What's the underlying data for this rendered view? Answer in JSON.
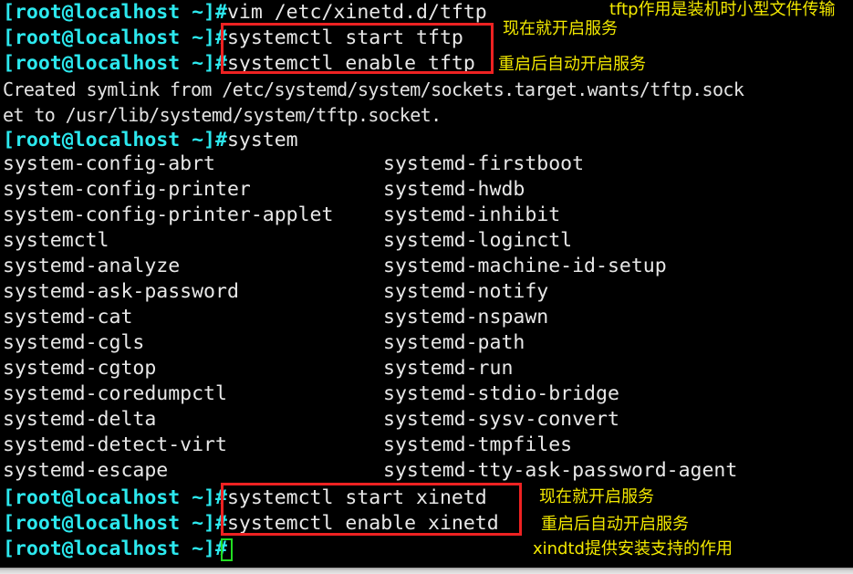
{
  "terminal": {
    "prompt": "[root@localhost ~]#",
    "colors": {
      "background": "#000000",
      "prompt": "#2ce8ee",
      "text": "#e8e8e8",
      "cursor": "#22dd22",
      "annotation_box": "#ee2222",
      "annotation_text": "#f2e800"
    },
    "lines": [
      {
        "prompt": "[root@localhost ~]#",
        "command": "vim /etc/xinetd.d/tftp"
      },
      {
        "prompt": "[root@localhost ~]#",
        "command": "systemctl start tftp"
      },
      {
        "prompt": "[root@localhost ~]#",
        "command": "systemctl enable tftp"
      }
    ],
    "output": [
      "Created symlink from /etc/systemd/system/sockets.target.wants/tftp.sock",
      "et to /usr/lib/systemd/system/tftp.socket."
    ],
    "tab_line": {
      "prompt": "[root@localhost ~]#",
      "command": "system"
    },
    "completions": [
      {
        "left": "system-config-abrt",
        "right": "systemd-firstboot"
      },
      {
        "left": "system-config-printer",
        "right": "systemd-hwdb"
      },
      {
        "left": "system-config-printer-applet",
        "right": "systemd-inhibit"
      },
      {
        "left": "systemctl",
        "right": "systemd-loginctl"
      },
      {
        "left": "systemd-analyze",
        "right": "systemd-machine-id-setup"
      },
      {
        "left": "systemd-ask-password",
        "right": "systemd-notify"
      },
      {
        "left": "systemd-cat",
        "right": "systemd-nspawn"
      },
      {
        "left": "systemd-cgls",
        "right": "systemd-path"
      },
      {
        "left": "systemd-cgtop",
        "right": "systemd-run"
      },
      {
        "left": "systemd-coredumpctl",
        "right": "systemd-stdio-bridge"
      },
      {
        "left": "systemd-delta",
        "right": "systemd-sysv-convert"
      },
      {
        "left": "systemd-detect-virt",
        "right": "systemd-tmpfiles"
      },
      {
        "left": "systemd-escape",
        "right": "systemd-tty-ask-password-agent"
      }
    ],
    "lines_bottom": [
      {
        "prompt": "[root@localhost ~]#",
        "command": "systemctl start xinetd"
      },
      {
        "prompt": "[root@localhost ~]#",
        "command": "systemctl enable xinetd"
      },
      {
        "prompt": "[root@localhost ~]#",
        "command": ""
      }
    ]
  },
  "annotations": {
    "tftp_purpose": "tftp作用是装机时小型文件传输",
    "start_now_top": "现在就开启服务",
    "auto_start_top": "重启后自动开启服务",
    "start_now_bottom": "现在就开启服务",
    "auto_start_bottom": "重启后自动开启服务",
    "xinetd_purpose": "xindtd提供安装支持的作用"
  }
}
